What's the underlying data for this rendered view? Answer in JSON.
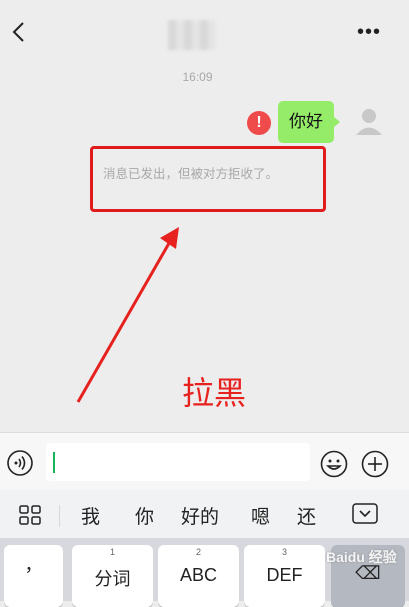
{
  "chat": {
    "timestamp": "16:09",
    "message": "你好",
    "error_mark": "!",
    "notice": "消息已发出，但被对方拒收了。"
  },
  "annotation": {
    "label": "拉黑",
    "color": "#e6211e"
  },
  "colors": {
    "bubble": "#95ec69",
    "error": "#f04b4b",
    "cursor": "#19b35a"
  },
  "candidates": [
    "我",
    "你",
    "好的",
    "嗯",
    "还"
  ],
  "keyboard": {
    "keys": [
      {
        "num": "",
        "label": "，"
      },
      {
        "num": "1",
        "label": "分词"
      },
      {
        "num": "2",
        "label": "ABC"
      },
      {
        "num": "3",
        "label": "DEF"
      },
      {
        "num": "",
        "label": "⌫"
      }
    ]
  },
  "watermark": "Baidu 经验"
}
